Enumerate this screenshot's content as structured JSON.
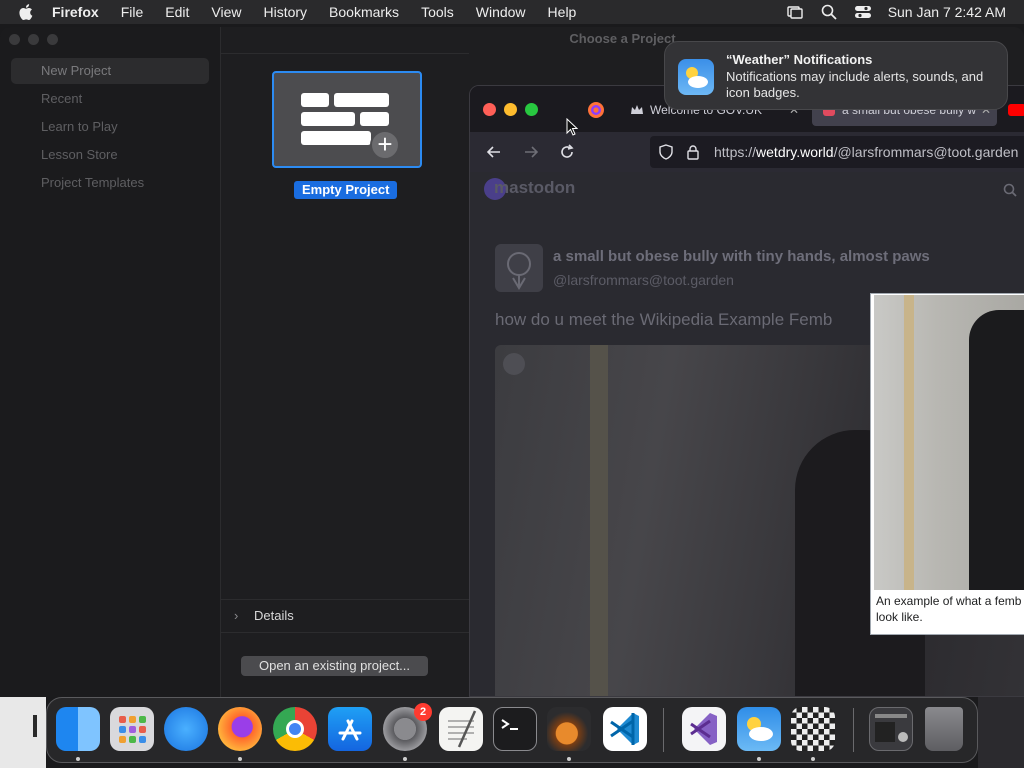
{
  "menubar": {
    "app_name": "Firefox",
    "items": [
      "File",
      "Edit",
      "View",
      "History",
      "Bookmarks",
      "Tools",
      "Window",
      "Help"
    ],
    "clock": "Sun Jan 7  2:42 AM"
  },
  "garageband": {
    "title": "Choose a Project",
    "sidebar": [
      "New Project",
      "Recent",
      "Learn to Play",
      "Lesson Store",
      "Project Templates"
    ],
    "project_label": "Empty Project",
    "details_label": "Details",
    "open_button": "Open an existing project..."
  },
  "firefox": {
    "tabs": [
      {
        "label": "Welcome to GOV.UK"
      },
      {
        "label": "a small but obese bully w"
      }
    ],
    "url_prefix": "https://",
    "url_domain": "wetdry.world",
    "url_path": "/@larsfrommars@toot.garden"
  },
  "mastodon": {
    "logo": "mastodon",
    "display_name": "a small but obese bully with tiny hands, almost paws",
    "handle": "@larsfrommars@toot.garden",
    "post_text": "how do u meet the Wikipedia Example Femb"
  },
  "wiki_popup": {
    "caption_line1": "An example of what a femb",
    "caption_line2": "look like."
  },
  "notification": {
    "title": "“Weather” Notifications",
    "body": "Notifications may include alerts, sounds, and icon badges."
  },
  "dock": {
    "apps": [
      "Finder",
      "Launchpad",
      "Safari",
      "Firefox",
      "Chrome",
      "App Store",
      "System Settings",
      "TextEdit",
      "Terminal",
      "GarageBand",
      "Visual Studio Code",
      "Visual Studio",
      "Weather",
      "Chess",
      "Screenshot",
      "Trash"
    ],
    "settings_badge": "2"
  }
}
